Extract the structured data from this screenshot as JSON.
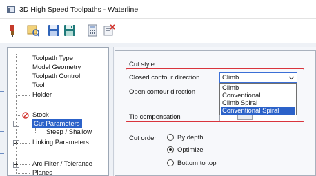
{
  "window": {
    "title": "3D High Speed Toolpaths - Waterline"
  },
  "toolbar": {
    "icons": [
      "tool-icon",
      "preview-icon",
      "save-icon",
      "save-as-icon",
      "calculator-icon",
      "delete-icon"
    ]
  },
  "tree": {
    "items": [
      {
        "label": "Toolpath Type"
      },
      {
        "label": "Model Geometry"
      },
      {
        "label": "Toolpath Control"
      },
      {
        "label": "Tool"
      },
      {
        "label": "Holder"
      },
      {
        "label": "Stock"
      },
      {
        "label": "Cut Parameters"
      },
      {
        "label": "Steep / Shallow"
      },
      {
        "label": "Linking Parameters"
      },
      {
        "label": "Arc Filter / Tolerance"
      },
      {
        "label": "Planes"
      }
    ],
    "selected": "Cut Parameters"
  },
  "cut_style": {
    "group_label": "Cut style",
    "closed_contour_label": "Closed contour direction",
    "closed_contour_value": "Climb",
    "open_contour_label": "Open contour direction",
    "dropdown_options": [
      "Climb",
      "Conventional",
      "Climb Spiral",
      "Conventional Spiral"
    ],
    "dropdown_highlighted": "Conventional Spiral",
    "tip_compensation_label": "Tip compensation"
  },
  "cut_order": {
    "label": "Cut order",
    "options": [
      {
        "label": "By depth",
        "selected": false
      },
      {
        "label": "Optimize",
        "selected": true
      },
      {
        "label": "Bottom to top",
        "selected": false
      }
    ]
  },
  "colors": {
    "highlight_border": "#d9343c",
    "selection": "#2c62c9"
  }
}
